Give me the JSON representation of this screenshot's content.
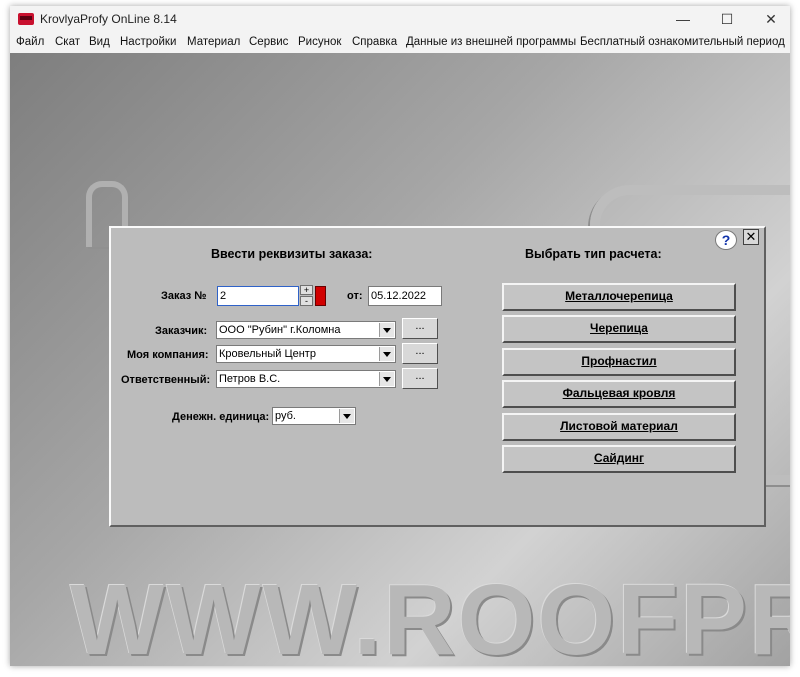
{
  "window": {
    "title": "KrovlyaProfy OnLine 8.14",
    "minimize": "—",
    "maximize": "☐",
    "close": "✕"
  },
  "menu": [
    "Файл",
    "Скат",
    "Вид",
    "Настройки",
    "Материал",
    "Сервис",
    "Рисунок",
    "Справка",
    "Данные из внешней программы",
    "Бесплатный ознакомительный период"
  ],
  "watermark": {
    "text": "WWW.ROOFPRO"
  },
  "dialog": {
    "left_heading": "Ввести реквизиты заказа:",
    "right_heading": "Выбрать тип расчета:",
    "help": "?",
    "close": "✕",
    "order": {
      "label": "Заказ №",
      "value": "2",
      "spin_up": "+",
      "spin_down": "-",
      "date_label": "от:",
      "date_value": "05.12.2022"
    },
    "customer": {
      "label": "Заказчик:",
      "value": "ООО \"Рубин\" г.Коломна",
      "more": "..."
    },
    "company": {
      "label": "Моя компания:",
      "value": "Кровельный Центр",
      "more": "..."
    },
    "responsible": {
      "label": "Ответственный:",
      "value": "Петров В.С.",
      "more": "..."
    },
    "currency": {
      "label": "Денежн. единица:",
      "value": "руб."
    },
    "calc_types": [
      "Металлочерепица",
      "Черепица",
      "Профнастил",
      "Фальцевая кровля",
      "Листовой материал",
      "Сайдинг"
    ]
  }
}
